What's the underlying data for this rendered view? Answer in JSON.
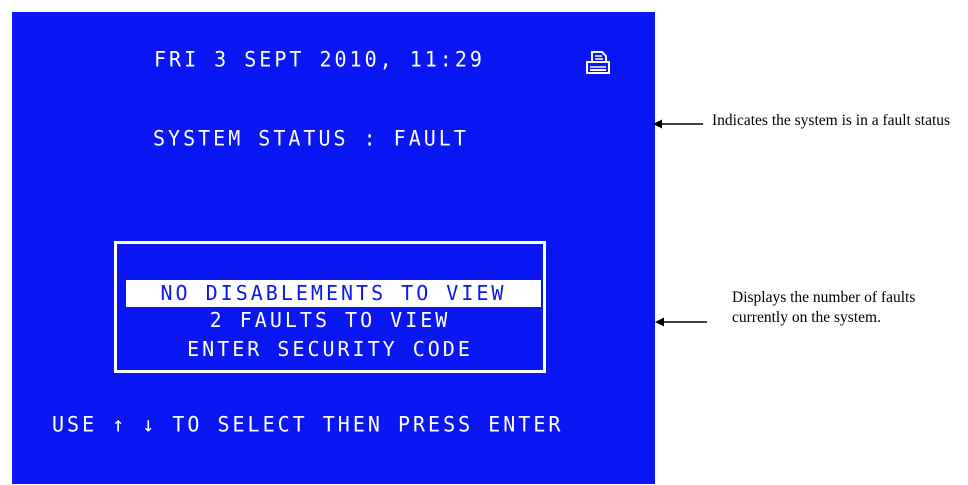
{
  "screen": {
    "datetime": "FRI 3 SEPT 2010, 11:29",
    "status": "SYSTEM STATUS : FAULT",
    "menu": [
      {
        "label": "NO DISABLEMENTS TO VIEW",
        "selected": true
      },
      {
        "label": "2 FAULTS TO VIEW",
        "selected": false
      },
      {
        "label": "ENTER SECURITY CODE",
        "selected": false
      }
    ],
    "hint": "USE ↑ ↓ TO SELECT THEN PRESS ENTER",
    "printer_icon": "printer-icon",
    "colors": {
      "background": "#0a17f2",
      "text": "#ffffff"
    }
  },
  "annotations": [
    {
      "text": "Indicates the system is in a fault status"
    },
    {
      "text": "Displays the number of faults currently on the system."
    }
  ]
}
